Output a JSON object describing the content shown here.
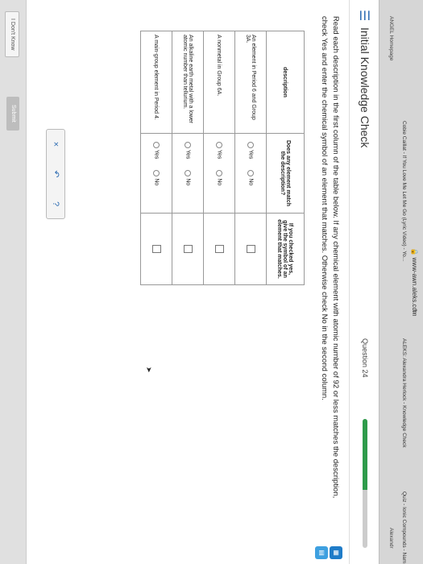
{
  "browser": {
    "url": "www-awn.aleks.com",
    "tabs": [
      "Cobie Caillat - If You Love Me Let Me Go (Lyric Video) - Yo...",
      "ALEKS: Alexandra Herlock - Knowledge Check",
      "Quiz - Ionic Compounds - Nam"
    ],
    "bookmarks": [
      "ANGEL Homepage",
      "Alexandr"
    ]
  },
  "header": {
    "title": "Initial Knowledge Check",
    "question": "Question 24",
    "progress": 0.55
  },
  "instructions": "Read each description in the first column of the table below. If any chemical element with atomic number of 92 or less matches the description, check Yes and enter the chemical symbol of an element that matches. Otherwise check No in the second column.",
  "table": {
    "headers": {
      "description": "description",
      "match": "Does any element match the description?",
      "symbol": "If you checked yes, give the symbol of an element that matches."
    },
    "rows": [
      {
        "description": "An element in Period 6 and Group 3A.",
        "yes": "Yes",
        "no": "No"
      },
      {
        "description": "A nonmetal in Group 6A.",
        "yes": "Yes",
        "no": "No"
      },
      {
        "description": "An alkaline earth metal with a lower atomic number than tellurium.",
        "yes": "Yes",
        "no": "No"
      },
      {
        "description": "A main-group element in Period 4.",
        "yes": "Yes",
        "no": "No"
      }
    ]
  },
  "controls": {
    "clear": "×",
    "undo": "↶",
    "help": "?"
  },
  "footer": {
    "dont_know": "I Don't Know",
    "submit": "Submit"
  },
  "colors": {
    "accent": "#2f6db3",
    "progress": "#2e9b4a"
  }
}
